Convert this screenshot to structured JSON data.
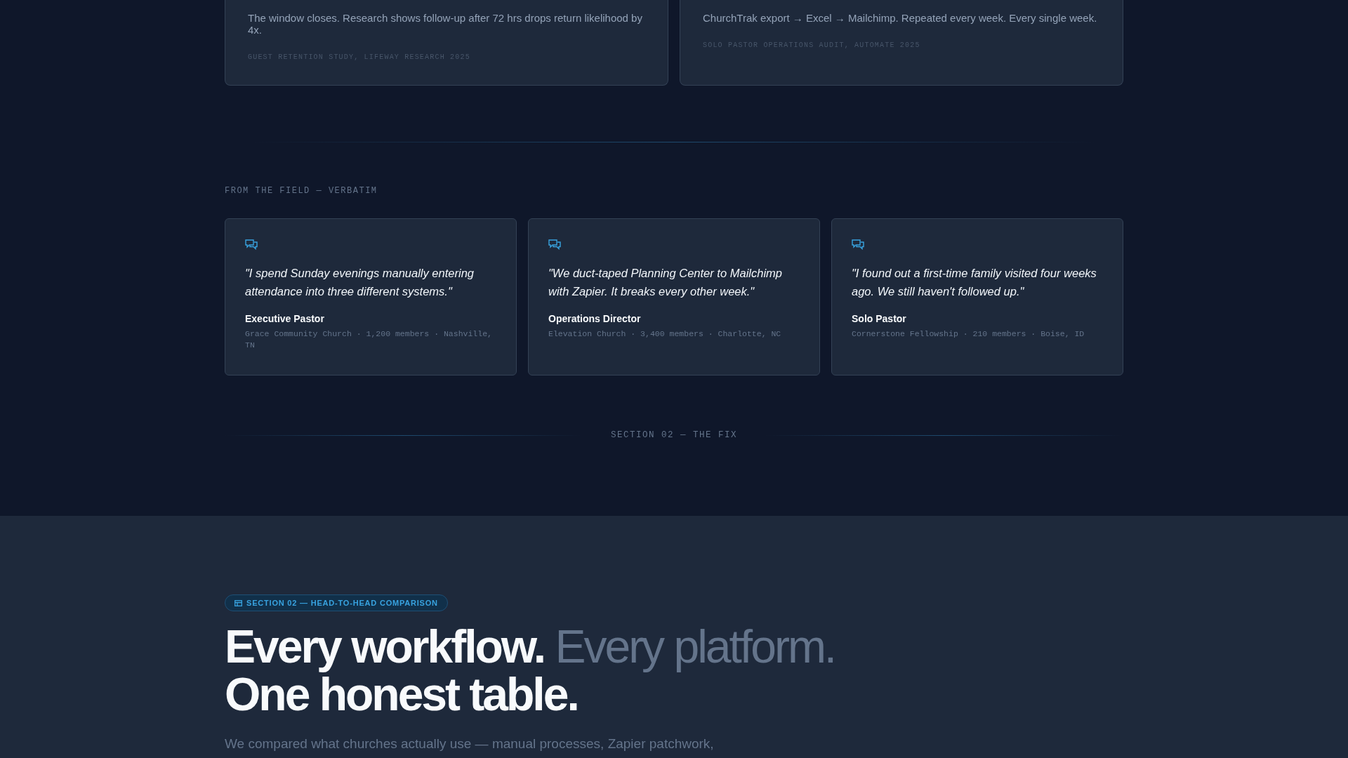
{
  "problem_cards": [
    {
      "body": "The window closes. Research shows follow-up after 72 hrs drops return likelihood by 4x.",
      "source": "GUEST RETENTION STUDY, LIFEWAY RESEARCH 2025"
    },
    {
      "body": "ChurchTrak export → Excel → Mailchimp. Repeated every week. Every single week.",
      "source": "SOLO PASTOR OPERATIONS AUDIT, AUTOMATE 2025"
    }
  ],
  "field_label": "FROM THE FIELD — VERBATIM",
  "quotes": [
    {
      "quote": "\"I spend Sunday evenings manually entering attendance into three different systems.\"",
      "role": "Executive Pastor",
      "meta": "Grace Community Church · 1,200 members · Nashville, TN"
    },
    {
      "quote": "\"We duct-taped Planning Center to Mailchimp with Zapier. It breaks every other week.\"",
      "role": "Operations Director",
      "meta": "Elevation Church · 3,400 members · Charlotte, NC"
    },
    {
      "quote": "\"I found out a first-time family visited four weeks ago. We still haven't followed up.\"",
      "role": "Solo Pastor",
      "meta": "Cornerstone Fellowship · 210 members · Boise, ID"
    }
  ],
  "section_divider": "SECTION 02 — THE FIX",
  "comparison": {
    "badge": "SECTION 02 — HEAD-TO-HEAD COMPARISON",
    "headline_strong": "Every workflow.",
    "headline_muted": "Every platform.",
    "headline_line2": "One honest table.",
    "intro": "We compared what churches actually use — manual processes, Zapier patchwork,"
  }
}
